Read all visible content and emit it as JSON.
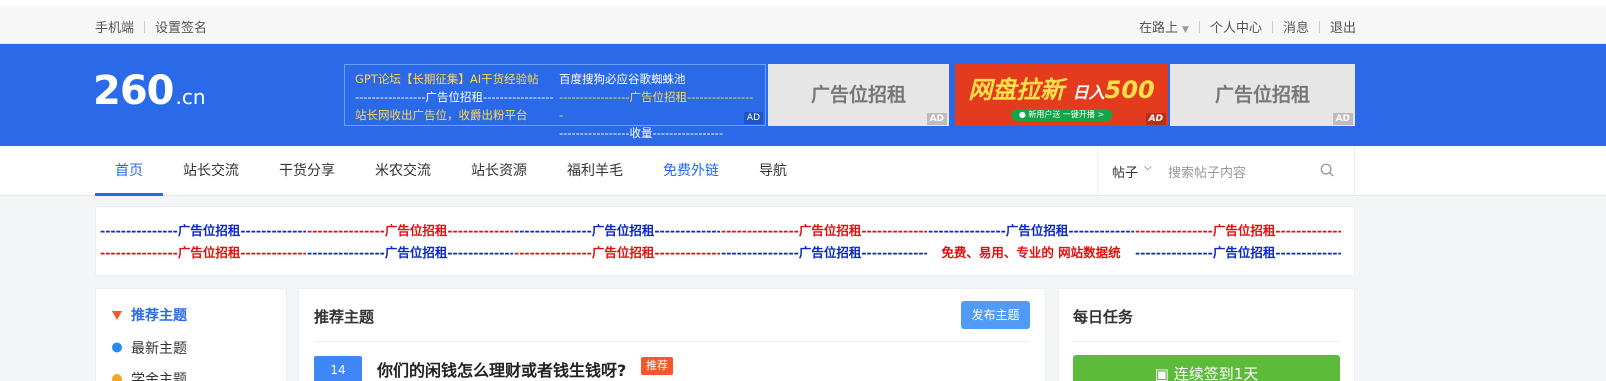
{
  "topbar": {
    "left": [
      "手机端",
      "设置签名"
    ],
    "right": [
      "在路上",
      "个人中心",
      "消息",
      "退出"
    ]
  },
  "logo": {
    "main": "260",
    "suffix": ".cn"
  },
  "header_ad_text": {
    "col1": [
      "GPT论坛【长期征集】AI干货经验帖",
      "-----------------广告位招租-----------------",
      "站长网收出广告位，收爵出粉平台"
    ],
    "col2": [
      "百度搜狗必应谷歌蜘蛛池",
      "-----------------广告位招租-----------------",
      "-----------------收量-----------------"
    ],
    "ad_label": "AD"
  },
  "header_ads": [
    {
      "text": "广告位招租",
      "ad": "AD"
    },
    {
      "text": "网盘拉新",
      "text2": "日入",
      "text3": "500",
      "sub": "● 新用户送 一键开播 >",
      "ad": "AD"
    },
    {
      "text": "广告位招租",
      "ad": "AD"
    }
  ],
  "nav": {
    "items": [
      "首页",
      "站长交流",
      "干货分享",
      "米农交流",
      "站长资源",
      "福利羊毛",
      "免费外链",
      "导航"
    ],
    "search_type": "帖子",
    "search_placeholder": "搜索帖子内容"
  },
  "ad_links": {
    "row1": [
      {
        "text": "---------------广告位招租-------------",
        "color": "blue"
      },
      {
        "text": "---------------广告位招租-------------",
        "color": "red"
      },
      {
        "text": "---------------广告位招租-------------",
        "color": "blue"
      },
      {
        "text": "---------------广告位招租-------------",
        "color": "red"
      },
      {
        "text": "---------------广告位招租-------------",
        "color": "blue"
      },
      {
        "text": "---------------广告位招租-------------",
        "color": "red"
      }
    ],
    "row2": [
      {
        "text": "---------------广告位招租-------------",
        "color": "red"
      },
      {
        "text": "---------------广告位招租-------------",
        "color": "blue"
      },
      {
        "text": "---------------广告位招租-------------",
        "color": "red"
      },
      {
        "text": "---------------广告位招租-------------",
        "color": "blue"
      },
      {
        "text": "免费、易用、专业的 网站数据统",
        "color": "red"
      },
      {
        "text": "---------------广告位招租-------------",
        "color": "blue"
      }
    ]
  },
  "sidebar": {
    "items": [
      "推荐主题",
      "最新主题",
      "学金主题"
    ]
  },
  "main": {
    "title": "推荐主题",
    "post_button": "发布主题",
    "post": {
      "num": "14",
      "title": "你们的闲钱怎么理财或者钱生钱呀?",
      "tag": "推荐"
    }
  },
  "task": {
    "title": "每日任务",
    "sign_button": "连续签到1天"
  },
  "colors": {
    "brand": "#2a6ae9",
    "blue_link": "#0b27c9",
    "red_link": "#e30e0e",
    "green": "#5dbb3c"
  }
}
